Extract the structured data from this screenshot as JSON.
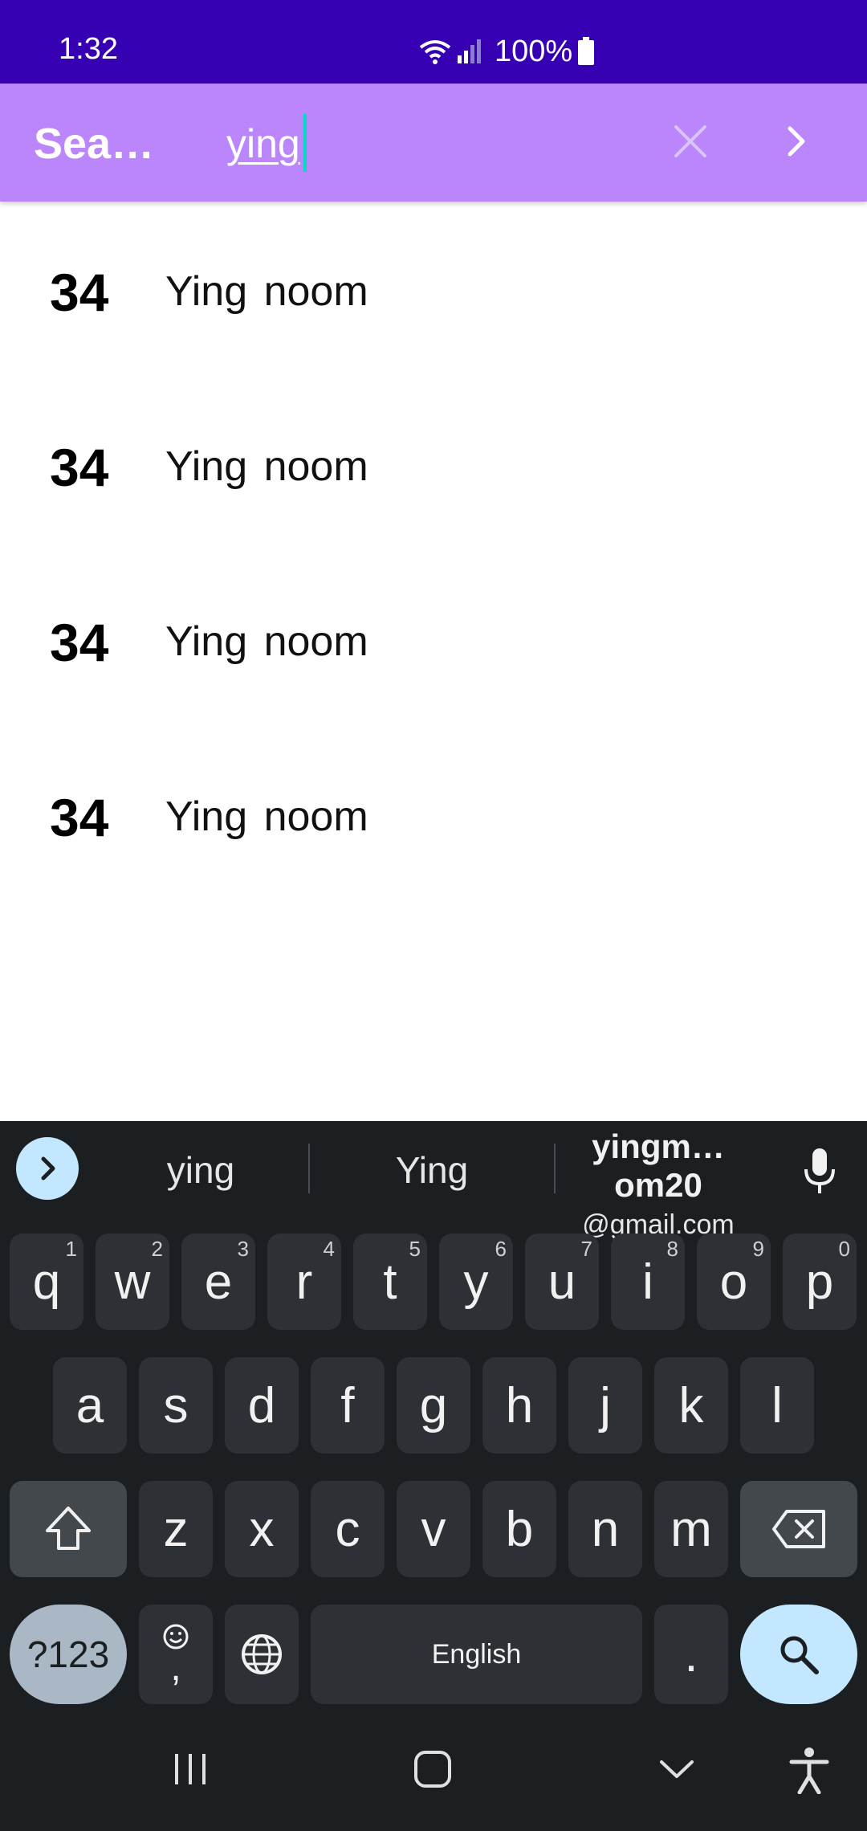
{
  "status_bar": {
    "time": "1:32",
    "battery_percent": "100%",
    "icons": [
      "wifi-icon",
      "signal-icon",
      "battery-icon"
    ]
  },
  "app_bar": {
    "title": "Sear…",
    "search_value": "ying",
    "clear_icon": "close-icon",
    "go_icon": "chevron-right-icon"
  },
  "results": [
    {
      "number": "34",
      "name": "Ying noom"
    },
    {
      "number": "34",
      "name": "Ying noom"
    },
    {
      "number": "34",
      "name": "Ying noom"
    },
    {
      "number": "34",
      "name": "Ying noom"
    }
  ],
  "keyboard": {
    "suggestions": [
      "ying",
      "Ying"
    ],
    "email_suggestion_line1": "yingm…om20",
    "email_suggestion_line2": "@gmail.com",
    "row1": [
      {
        "label": "q",
        "hint": "1"
      },
      {
        "label": "w",
        "hint": "2"
      },
      {
        "label": "e",
        "hint": "3"
      },
      {
        "label": "r",
        "hint": "4"
      },
      {
        "label": "t",
        "hint": "5"
      },
      {
        "label": "y",
        "hint": "6"
      },
      {
        "label": "u",
        "hint": "7"
      },
      {
        "label": "i",
        "hint": "8"
      },
      {
        "label": "o",
        "hint": "9"
      },
      {
        "label": "p",
        "hint": "0"
      }
    ],
    "row2": [
      "a",
      "s",
      "d",
      "f",
      "g",
      "h",
      "j",
      "k",
      "l"
    ],
    "row3": [
      "z",
      "x",
      "c",
      "v",
      "b",
      "n",
      "m"
    ],
    "symbols_label": "?123",
    "comma_label": ",",
    "space_label": "English",
    "period_label": ".",
    "colors": {
      "accent": "#3700b3",
      "app_bar": "#bb86fc",
      "keyboard_bg": "#1b1f22",
      "key_bg": "#2d3135",
      "action_key": "#c3e7ff"
    }
  }
}
